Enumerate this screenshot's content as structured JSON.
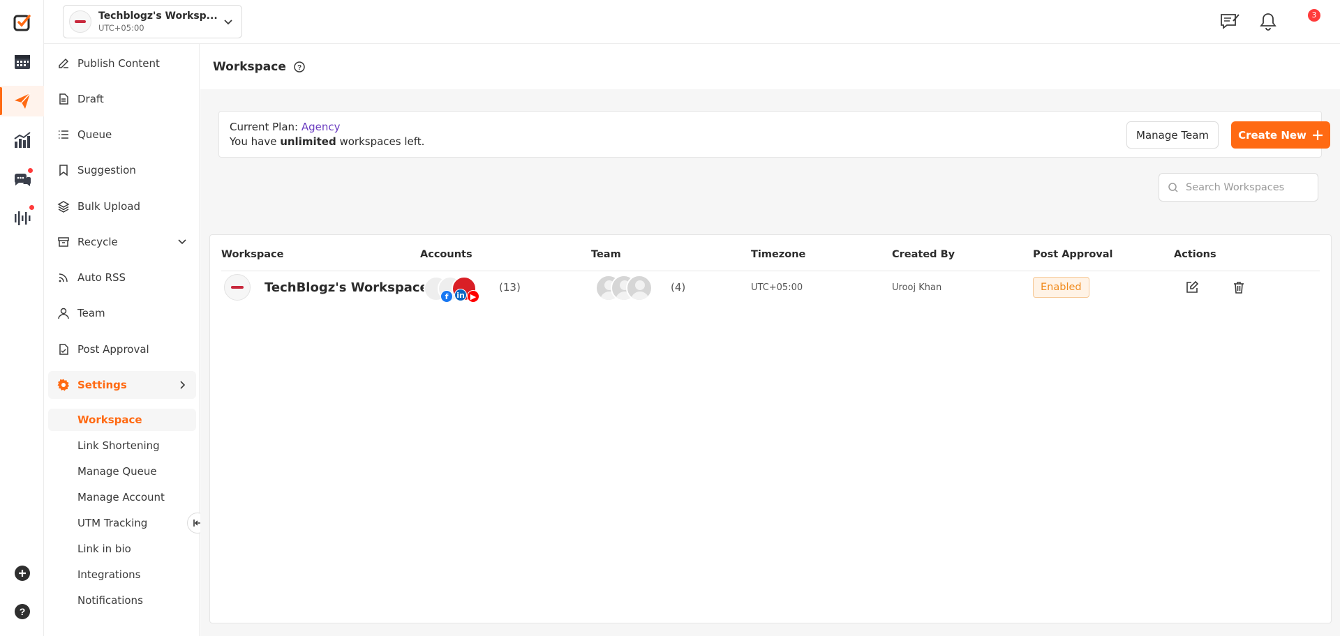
{
  "rail": {
    "items": [
      {
        "name": "logo-icon"
      },
      {
        "name": "calendar-icon"
      },
      {
        "name": "send-icon"
      },
      {
        "name": "analytics-icon"
      },
      {
        "name": "chat-icon"
      },
      {
        "name": "audio-bars-icon"
      }
    ],
    "bottom": [
      {
        "name": "add-icon"
      },
      {
        "name": "help-icon"
      }
    ]
  },
  "topbar": {
    "workspace_name": "Techblogz's Worksp...",
    "workspace_tz": "UTC+05:00",
    "notifications_count": "3"
  },
  "sidebar": {
    "items": [
      {
        "label": "Publish Content",
        "icon": "pen-icon"
      },
      {
        "label": "Draft",
        "icon": "document-icon"
      },
      {
        "label": "Queue",
        "icon": "list-icon"
      },
      {
        "label": "Suggestion",
        "icon": "bookmark-icon"
      },
      {
        "label": "Bulk Upload",
        "icon": "layers-icon"
      },
      {
        "label": "Recycle",
        "icon": "archive-icon"
      },
      {
        "label": "Auto RSS",
        "icon": "rss-icon"
      },
      {
        "label": "Team",
        "icon": "user-icon"
      },
      {
        "label": "Post Approval",
        "icon": "approval-icon"
      },
      {
        "label": "Settings",
        "icon": "gear-icon"
      }
    ],
    "settings_sub": [
      {
        "label": "Workspace"
      },
      {
        "label": "Link Shortening"
      },
      {
        "label": "Manage Queue"
      },
      {
        "label": "Manage Account"
      },
      {
        "label": "UTM Tracking"
      },
      {
        "label": "Link in bio"
      },
      {
        "label": "Integrations"
      },
      {
        "label": "Notifications"
      }
    ]
  },
  "main": {
    "title": "Workspace",
    "plan": {
      "prefix": "Current Plan: ",
      "name": "Agency",
      "line2_prefix": "You have ",
      "line2_bold": "unlimited",
      "line2_suffix": " workspaces left."
    },
    "manage_team_label": "Manage Team",
    "create_new_label": "Create New",
    "search_placeholder": "Search Workspaces",
    "table": {
      "headers": [
        "Workspace",
        "Accounts",
        "Team",
        "Timezone",
        "Created By",
        "Post Approval",
        "Actions"
      ],
      "rows": [
        {
          "workspace": "TechBlogz's Workspace",
          "accounts_count": "(13)",
          "team_count": "(4)",
          "timezone": "UTC+05:00",
          "created_by": "Urooj Khan",
          "post_approval": "Enabled"
        }
      ]
    }
  },
  "colors": {
    "accent": "#ff6a13",
    "plan": "#6a3cc0",
    "badge_text": "#f08a1c"
  }
}
